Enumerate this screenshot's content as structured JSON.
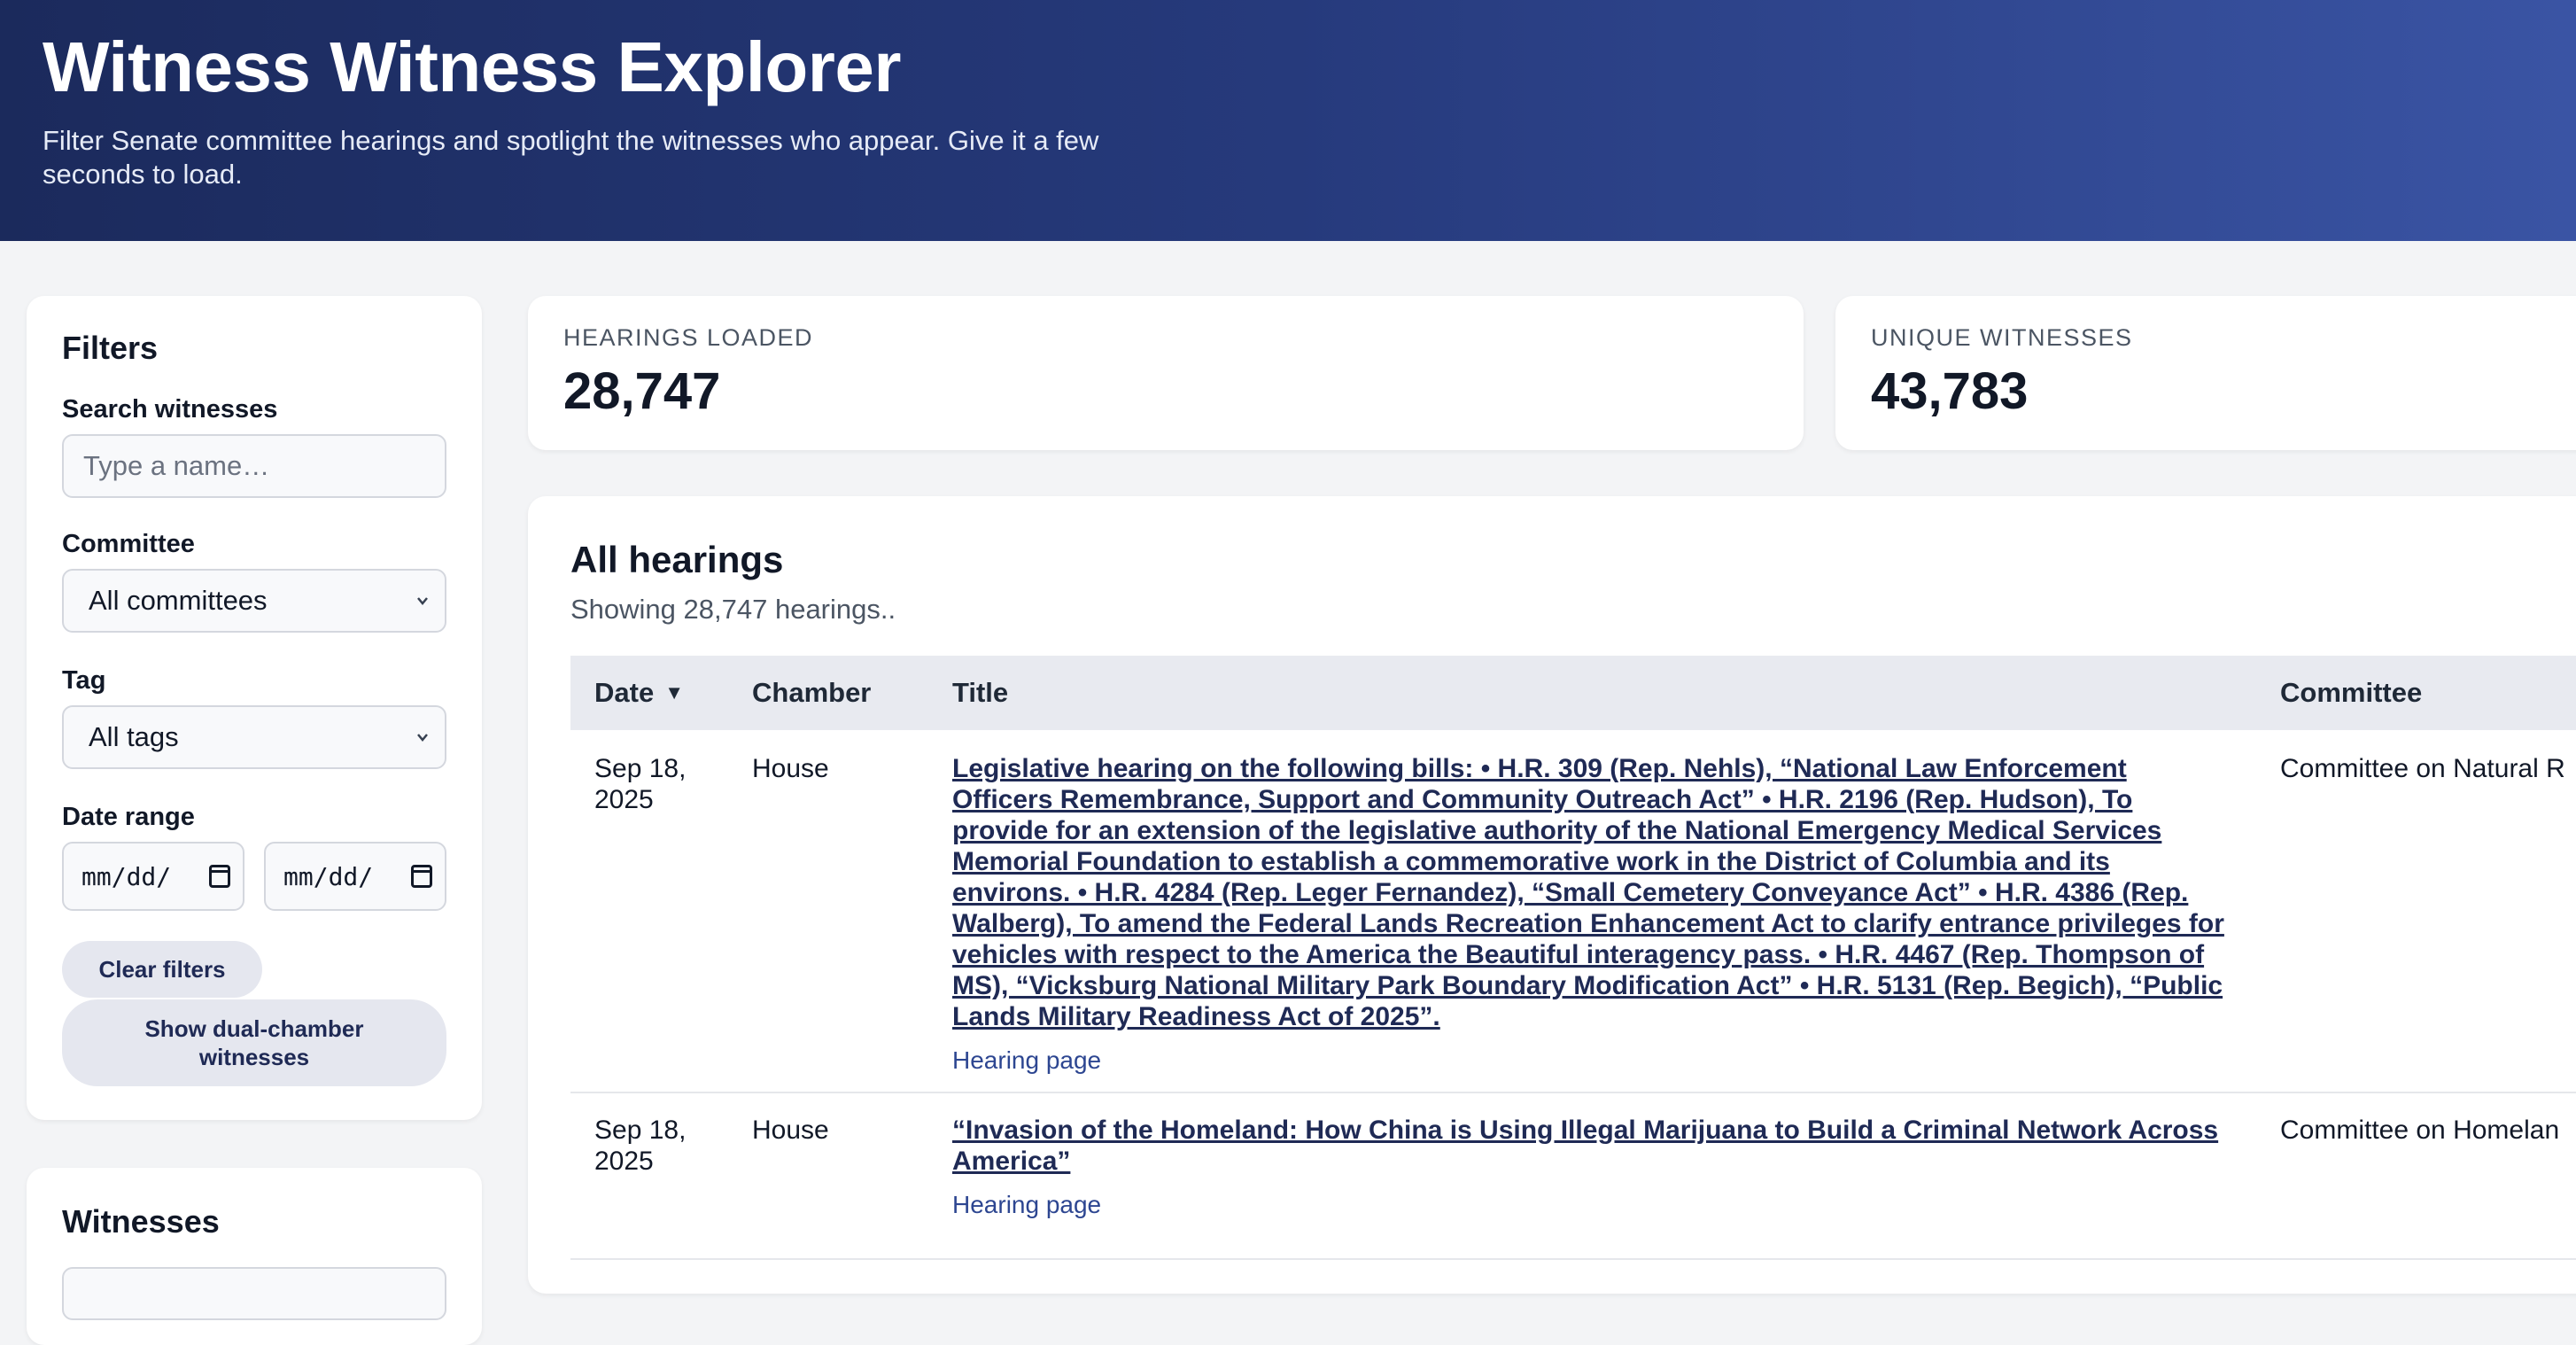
{
  "header": {
    "title": "Witness Witness Explorer",
    "subtitle": "Filter Senate committee hearings and spotlight the witnesses who appear. Give it a few seconds to load."
  },
  "filters": {
    "heading": "Filters",
    "search_label": "Search witnesses",
    "search_placeholder": "Type a name…",
    "committee_label": "Committee",
    "committee_value": "All committees",
    "tag_label": "Tag",
    "tag_value": "All tags",
    "date_range_label": "Date range",
    "date_start_placeholder": "mm/dd/",
    "date_end_placeholder": "mm/dd/",
    "clear_label": "Clear filters",
    "dual_chamber_label": "Show dual-chamber witnesses"
  },
  "witnesses": {
    "heading": "Witnesses"
  },
  "stats": [
    {
      "label": "HEARINGS LOADED",
      "value": "28,747"
    },
    {
      "label": "UNIQUE WITNESSES",
      "value": "43,783"
    }
  ],
  "hearings": {
    "heading": "All hearings",
    "showing": "Showing 28,747 hearings..",
    "columns": {
      "date": "Date",
      "chamber": "Chamber",
      "title": "Title",
      "committee": "Committee"
    },
    "sort_indicator": "▼",
    "rows": [
      {
        "date": "Sep 18, 2025",
        "chamber": "House",
        "title": "Legislative hearing on the following bills: • H.R. 309 (Rep. Nehls), “National Law Enforcement Officers Remembrance, Support and Community Outreach Act” • H.R. 2196 (Rep. Hudson), To provide for an extension of the legislative authority of the National Emergency Medical Services Memorial Foundation to establish a commemorative work in the District of Columbia and its environs. • H.R. 4284 (Rep. Leger Fernandez), “Small Cemetery Conveyance Act” • H.R. 4386 (Rep. Walberg), To amend the Federal Lands Recreation Enhancement Act to clarify entrance privileges for vehicles with respect to the America the Beautiful interagency pass. • H.R. 4467 (Rep. Thompson of MS), “Vicksburg National Military Park Boundary Modification Act” • H.R. 5131 (Rep. Begich), “Public Lands Military Readiness Act of 2025”.",
        "link": "Hearing page",
        "committee": "Committee on Natural R"
      },
      {
        "date": "Sep 18, 2025",
        "chamber": "House",
        "title": "“Invasion of the Homeland: How China is Using Illegal Marijuana to Build a Criminal Network Across America”",
        "link": "Hearing page",
        "committee": "Committee on Homelan"
      }
    ]
  }
}
